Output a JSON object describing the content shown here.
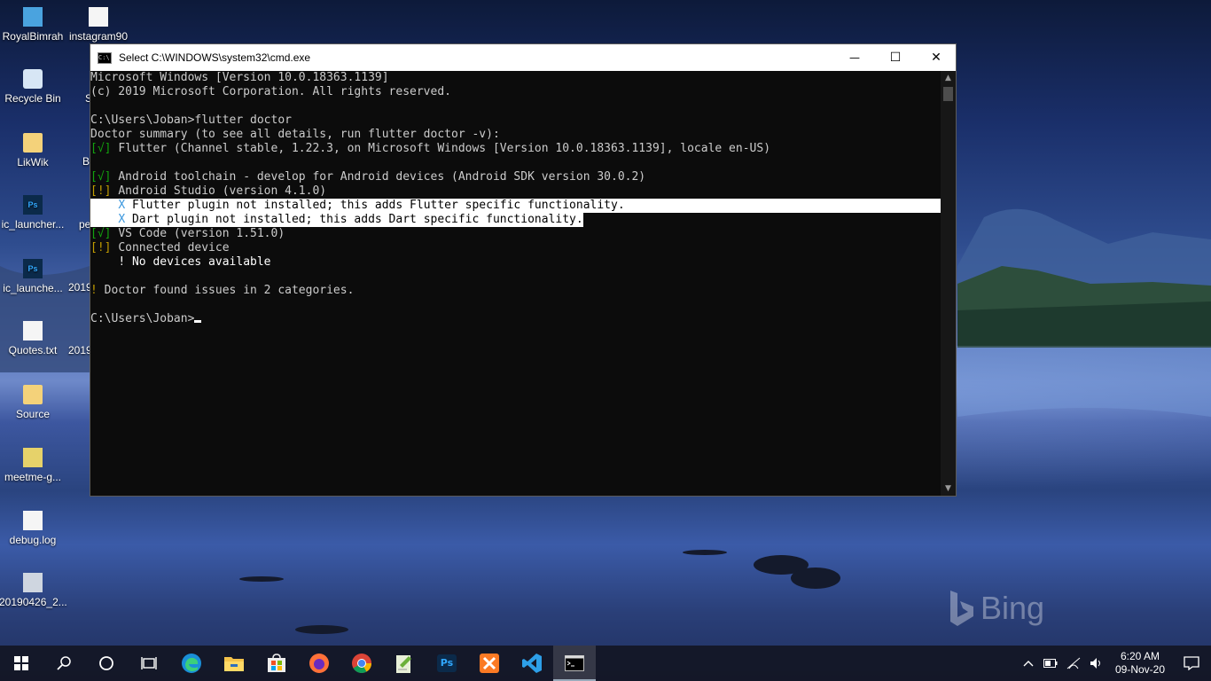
{
  "desktop": {
    "icons": [
      {
        "label": "RoyalBimrah",
        "type": "pc"
      },
      {
        "label": "instagram90",
        "type": "file"
      },
      {
        "label": "Recycle Bin",
        "type": "bin"
      },
      {
        "label": "LikWik",
        "type": "folder"
      },
      {
        "label": "ic_launcher...",
        "type": "ps"
      },
      {
        "label": "ic_launche...",
        "type": "ps"
      },
      {
        "label": "Quotes.txt",
        "type": "file"
      },
      {
        "label": "Source",
        "type": "folder"
      },
      {
        "label": "meetme-g...",
        "type": "mix"
      },
      {
        "label": "debug.log",
        "type": "file"
      },
      {
        "label": "20190426_2...",
        "type": "pic"
      }
    ],
    "partial_labels": [
      "S",
      "B",
      "pe",
      "2019",
      "2019"
    ],
    "watermark": "Bing"
  },
  "window": {
    "title": "Select C:\\WINDOWS\\system32\\cmd.exe",
    "minimize": "—",
    "maximize": "☐",
    "close": "✕"
  },
  "console": {
    "lines": [
      "Microsoft Windows [Version 10.0.18363.1139]",
      "(c) 2019 Microsoft Corporation. All rights reserved.",
      "",
      "C:\\Users\\Joban>flutter doctor",
      "Doctor summary (to see all details, run flutter doctor -v):",
      "Flutter (Channel stable, 1.22.3, on Microsoft Windows [Version 10.0.18363.1139], locale en-US)",
      "",
      "Android toolchain - develop for Android devices (Android SDK version 30.0.2)",
      "Android Studio (version 4.1.0)",
      "Flutter plugin not installed; this adds Flutter specific functionality.",
      "Dart plugin not installed; this adds Dart specific functionality.",
      "VS Code (version 1.51.0)",
      "Connected device",
      "No devices available",
      "",
      "Doctor found issues in 2 categories.",
      "",
      "C:\\Users\\Joban>"
    ],
    "mark_ok": "[√]",
    "mark_warn": "[!]",
    "mark_x": "X",
    "mark_bang": "!"
  },
  "taskbar": {
    "apps": [
      "start",
      "search",
      "cortana",
      "task-view",
      "edge",
      "file-explorer",
      "store",
      "firefox",
      "chrome",
      "notepad-plus-plus",
      "photoshop",
      "xampp",
      "vscode",
      "cmd"
    ],
    "time": "6:20 AM",
    "date": "09-Nov-20"
  },
  "colors": {
    "ok": "#13a10e",
    "warn": "#c19c00",
    "x": "#3a96dd"
  }
}
